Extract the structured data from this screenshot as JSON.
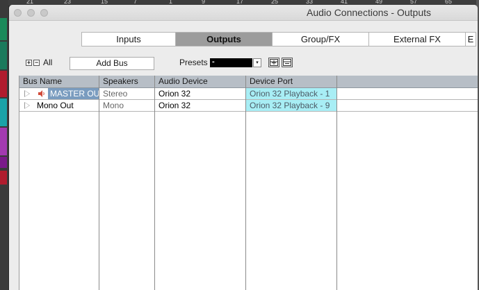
{
  "window": {
    "title": "Audio Connections - Outputs"
  },
  "ruler": [
    "21",
    "23",
    "15",
    "7",
    "1",
    "9",
    "17",
    "25",
    "33",
    "41",
    "49",
    "57",
    "65"
  ],
  "tabs": [
    "Inputs",
    "Outputs",
    "Group/FX",
    "External FX",
    "E"
  ],
  "active_tab": "Outputs",
  "toolbar": {
    "expand_label": "+",
    "collapse_label": "−",
    "all_label": "All",
    "add_bus_label": "Add Bus",
    "presets_label": "Presets",
    "preset_value": "-",
    "preset_arrow": "▾"
  },
  "table": {
    "columns": [
      "Bus Name",
      "Speakers",
      "Audio Device",
      "Device Port"
    ],
    "rows": [
      {
        "bus_name": "MASTER OUT",
        "speakers": "Stereo",
        "audio_device": "Orion 32",
        "device_port": "Orion 32 Playback - 1"
      },
      {
        "bus_name": "Mono Out",
        "speakers": "Mono",
        "audio_device": "Orion 32",
        "device_port": "Orion 32 Playback - 9"
      }
    ]
  },
  "colors": {
    "selection": "#7a9cbf",
    "port_highlight": "#a8eef5",
    "header": "#b7bec6",
    "active_tab": "#9c9c9c"
  }
}
